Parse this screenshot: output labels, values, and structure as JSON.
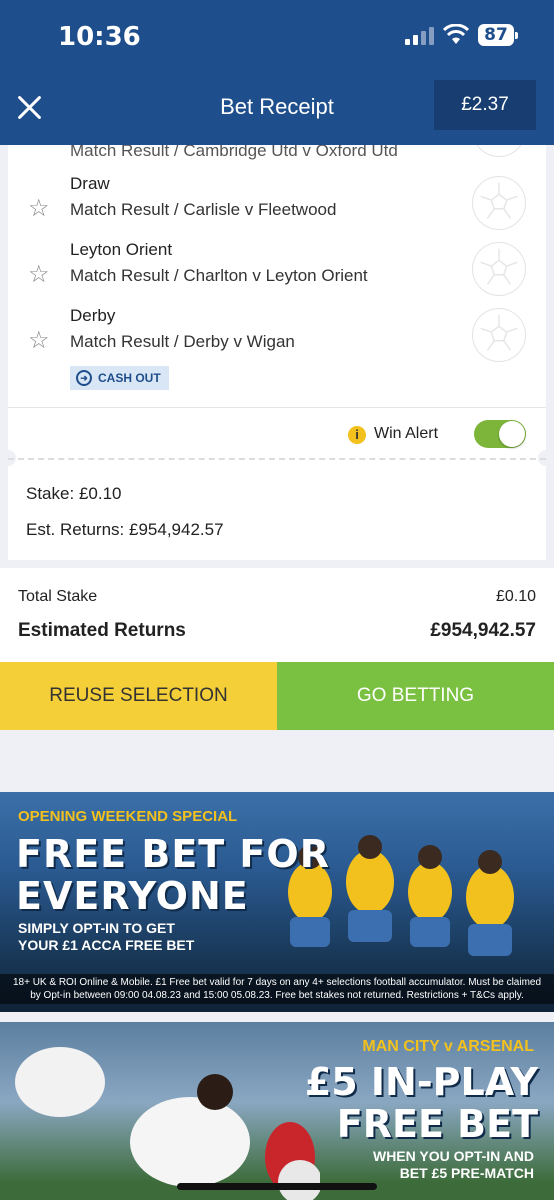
{
  "status": {
    "time": "10:36",
    "battery": "87"
  },
  "header": {
    "title": "Bet Receipt",
    "balance": "£2.37"
  },
  "selections": [
    {
      "name": "",
      "market": "Match Result / Cambridge Utd v Oxford Utd"
    },
    {
      "name": "Draw",
      "market": "Match Result / Carlisle v Fleetwood"
    },
    {
      "name": "Leyton Orient",
      "market": "Match Result / Charlton v Leyton Orient"
    },
    {
      "name": "Derby",
      "market": "Match Result / Derby v Wigan"
    }
  ],
  "bet": {
    "cashout_label": "CASH OUT",
    "win_alert_label": "Win Alert",
    "win_alert_on": true,
    "stake_label": "Stake:",
    "stake_value": "£0.10",
    "returns_label": "Est. Returns:",
    "returns_value": "£954,942.57"
  },
  "totals": {
    "total_stake_label": "Total Stake",
    "total_stake_value": "£0.10",
    "est_returns_label": "Estimated Returns",
    "est_returns_value": "£954,942.57"
  },
  "actions": {
    "reuse_label": "REUSE SELECTION",
    "go_label": "GO BETTING"
  },
  "promo1": {
    "kicker": "OPENING WEEKEND SPECIAL",
    "line1": "FREE BET FOR",
    "line2": "EVERYONE",
    "sub1": "SIMPLY OPT-IN TO GET",
    "sub2": "YOUR £1 ACCA FREE BET",
    "terms1": "18+ UK & ROI Online & Mobile. £1 Free bet valid for 7 days on any 4+ selections football accumulator. Must be claimed",
    "terms2": "by Opt-in between 09:00 04.08.23 and 15:00 05.08.23. Free bet stakes not returned. Restrictions + T&Cs apply."
  },
  "promo2": {
    "kicker": "MAN CITY v ARSENAL",
    "line1": "£5 IN-PLAY",
    "line2": "FREE BET",
    "sub1": "WHEN YOU OPT-IN AND",
    "sub2": "BET £5 PRE-MATCH"
  },
  "colors": {
    "brand": "#1f4e8c",
    "reuse": "#f5cf37",
    "go": "#7ac142",
    "toggle_on": "#7cb53a"
  }
}
